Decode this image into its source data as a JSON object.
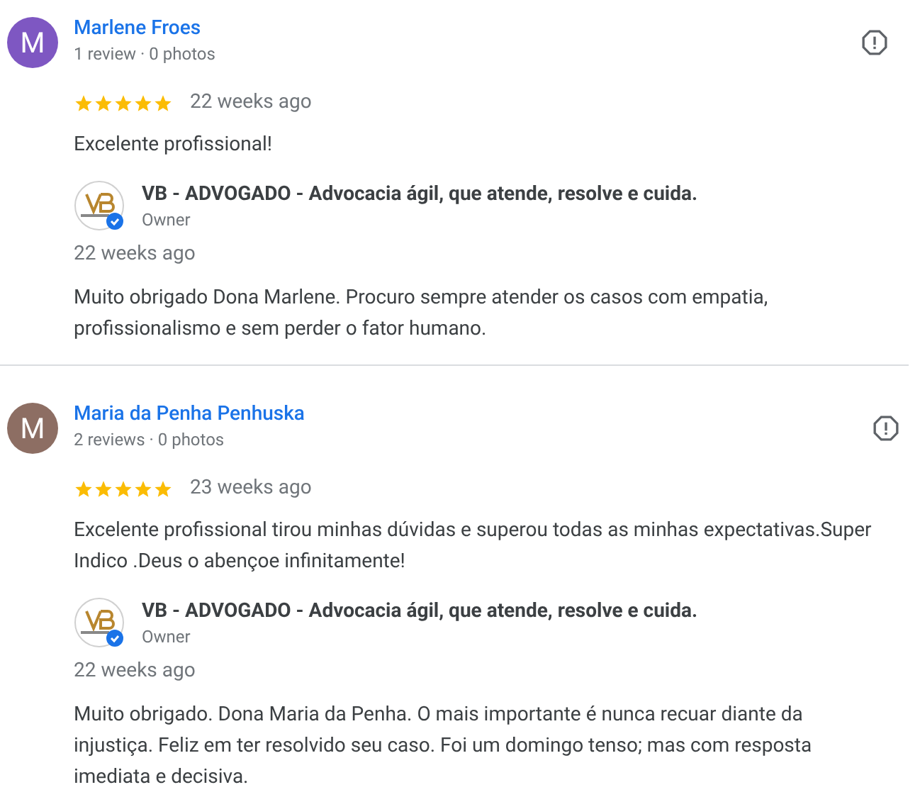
{
  "reviews": [
    {
      "initial": "M",
      "color": "#7e57c2",
      "name": "Marlene Froes",
      "meta": "1 review · 0 photos",
      "stars": 5,
      "time": "22 weeks ago",
      "text": "Excelente profissional!",
      "reply": {
        "owner": "VB - ADVOGADO - Advocacia ágil, que atende, resolve e cuida.",
        "role": "Owner",
        "time": "22 weeks ago",
        "text": "Muito obrigado Dona Marlene. Procuro sempre atender os casos com empatia, profissionalismo e sem perder o fator humano."
      }
    },
    {
      "initial": "M",
      "color": "#8d6e63",
      "name": "Maria da Penha Penhuska",
      "meta": "2 reviews · 0 photos",
      "stars": 5,
      "time": "23 weeks ago",
      "text": "Excelente profissional tirou minhas dúvidas e superou todas as minhas expectativas.Super Indico .Deus o abençoe infinitamente!",
      "reply": {
        "owner": "VB - ADVOGADO - Advocacia ágil, que atende, resolve e cuida.",
        "role": "Owner",
        "time": "22 weeks ago",
        "text": "Muito obrigado. Dona Maria da Penha. O mais importante é nunca recuar diante da injustiça. Feliz em ter resolvido seu caso. Foi um domingo tenso; mas com resposta imediata e decisiva."
      }
    }
  ]
}
